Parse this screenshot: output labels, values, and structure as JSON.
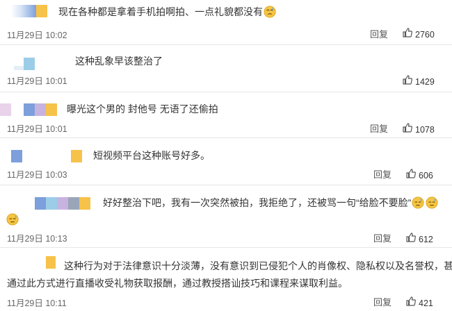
{
  "comments": [
    {
      "text": "现在各种都是拿着手机拍啊拍、一点礼貌都没有",
      "time": "11月29日 10:02",
      "reply": "回复",
      "likes": "2760"
    },
    {
      "text": "这种乱象早该整治了",
      "time": "11月29日 10:01",
      "reply": "",
      "likes": "1429"
    },
    {
      "text": "曝光这个男的 封他号 无语了还偷拍",
      "time": "11月29日 10:01",
      "reply": "回复",
      "likes": "1078"
    },
    {
      "text": "短视频平台这种账号好多。",
      "time": "11月29日 10:03",
      "reply": "回复",
      "likes": "606"
    },
    {
      "text": "好好整治下吧，我有一次突然被拍，我拒绝了，还被骂一句“给脸不要脸”",
      "time": "11月29日 10:13",
      "reply": "回复",
      "likes": "612"
    },
    {
      "text_line1": "这种行为对于法律意识十分淡薄，没有意识到已侵犯个人的肖像权、隐私权以及名誉权，甚至",
      "text_line2": "通过此方式进行直播收受礼物获取报酬，通过教授搭讪技巧和课程来谋取利益。",
      "time": "11月29日 10:11",
      "reply": "回复",
      "likes": "421"
    }
  ],
  "icons": {
    "like": "thumbs-up-icon",
    "emoji_sad": "sad-sweat-emoji-icon",
    "emoji_awkward": "awkward-sweat-emoji-icon"
  },
  "colors": {
    "blue": "#7d9fdb",
    "gold": "#f7c24a",
    "purple": "#c7b3e0",
    "pink": "#e8d3ea",
    "lightblue": "#9ccde8",
    "gray": "#9aa6b8"
  }
}
